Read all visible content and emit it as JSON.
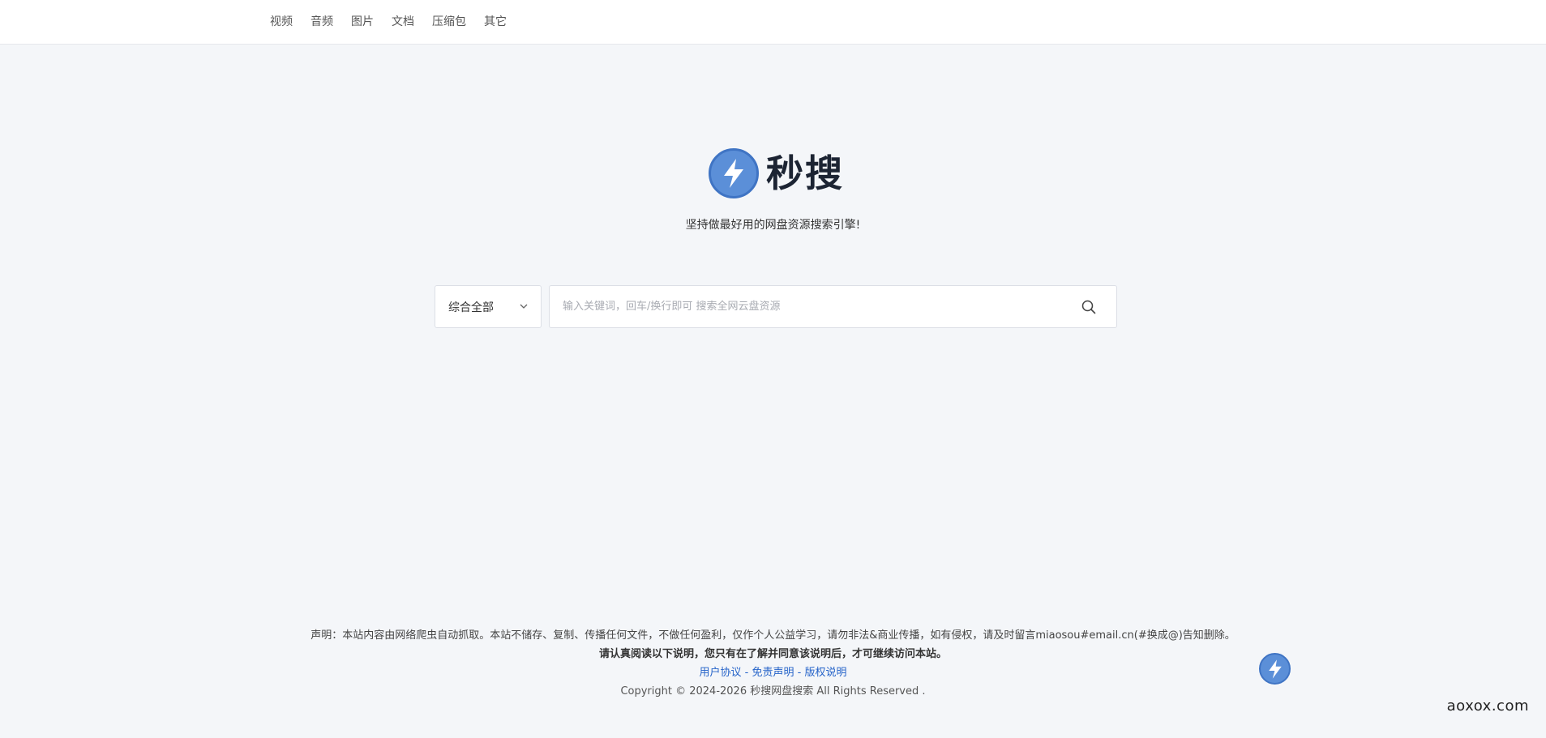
{
  "nav": {
    "items": [
      {
        "label": "视频"
      },
      {
        "label": "音频"
      },
      {
        "label": "图片"
      },
      {
        "label": "文档"
      },
      {
        "label": "压缩包"
      },
      {
        "label": "其它"
      }
    ]
  },
  "brand": {
    "name": "秒搜",
    "slogan": "坚持做最好用的网盘资源搜索引擎!",
    "icon": "lightning-bolt-icon",
    "accent_color": "#5b8fd8"
  },
  "search": {
    "category_selected": "综合全部",
    "placeholder": "输入关键词，回车/换行即可 搜索全网云盘资源",
    "value": ""
  },
  "footer": {
    "disclaimer": "声明：本站内容由网络爬虫自动抓取。本站不储存、复制、传播任何文件，不做任何盈利，仅作个人公益学习，请勿非法&商业传播，如有侵权，请及时留言miaosou#email.cn(#换成@)告知删除。",
    "notice": "请认真阅读以下说明，您只有在了解并同意该说明后，才可继续访问本站。",
    "links": {
      "user_agreement": "用户协议",
      "disclaimer": "免责声明",
      "copyright": "版权说明",
      "separator": " - "
    },
    "copyright": "Copyright © 2024-2026 秒搜网盘搜索 All Rights Reserved ."
  },
  "watermark": "aoxox.com"
}
